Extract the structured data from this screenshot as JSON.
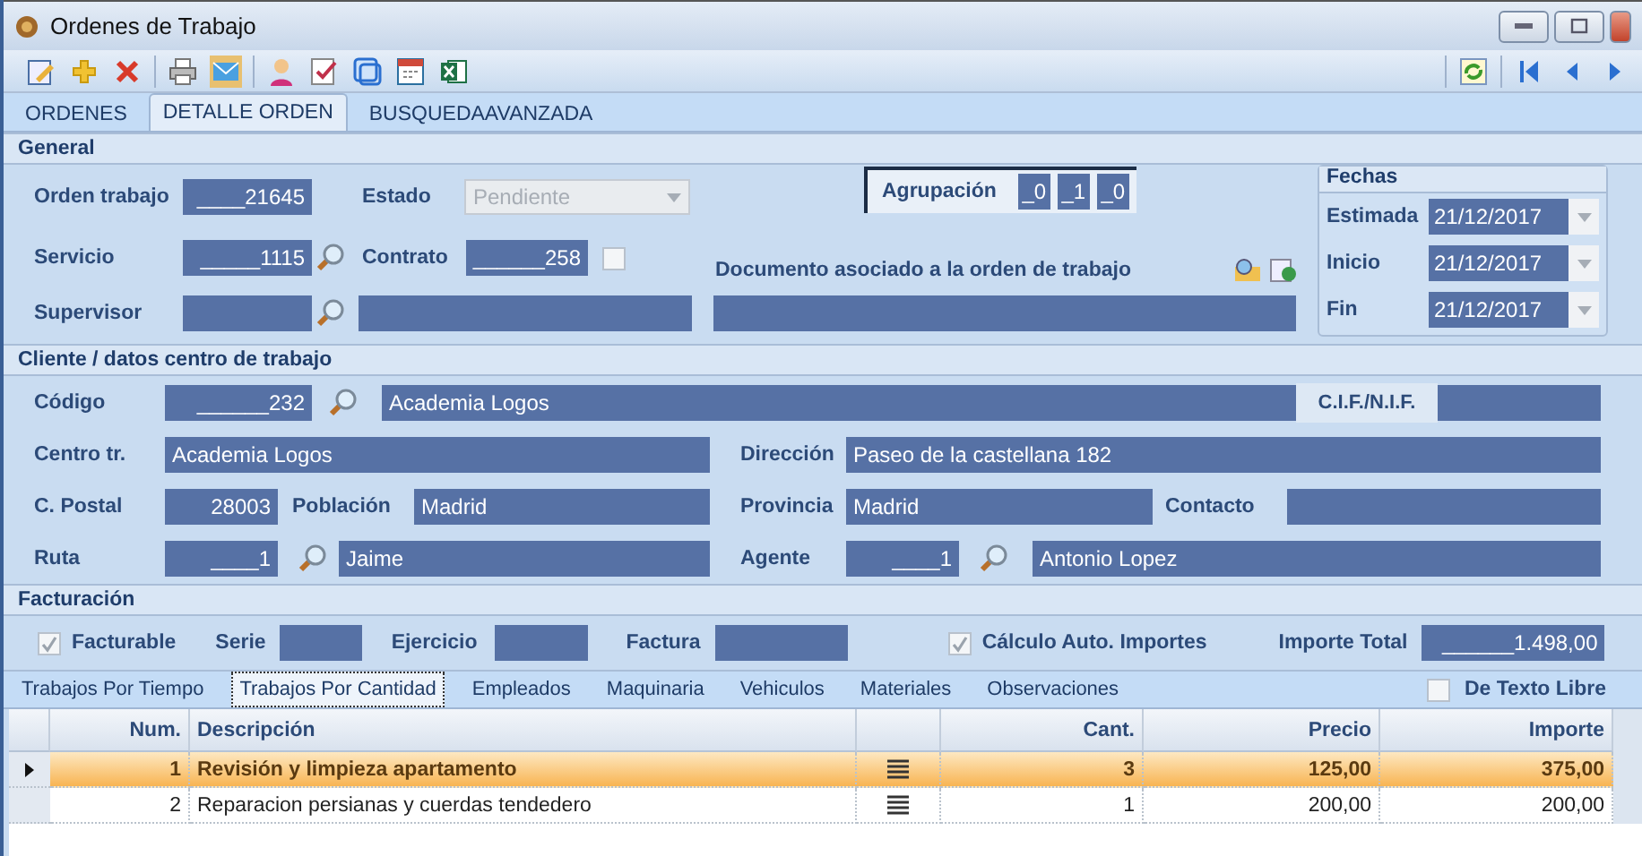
{
  "window": {
    "title": "Ordenes de Trabajo"
  },
  "tabs": [
    {
      "label": "ORDENES",
      "selected": false
    },
    {
      "label": "DETALLE ORDEN",
      "selected": true
    },
    {
      "label": "BUSQUEDAAVANZADA",
      "selected": false
    }
  ],
  "general": {
    "title": "General",
    "orden_trabajo": {
      "label": "Orden trabajo",
      "value": "____21645"
    },
    "estado": {
      "label": "Estado",
      "value": "Pendiente",
      "disabled": true
    },
    "agrupacion": {
      "label": "Agrupación",
      "values": [
        "_0",
        "_1",
        "_0"
      ]
    },
    "servicio": {
      "label": "Servicio",
      "value": "_____1115"
    },
    "contrato": {
      "label": "Contrato",
      "value": "______258",
      "checked": false
    },
    "supervisor": {
      "label": "Supervisor"
    },
    "documento": {
      "label": "Documento asociado a la orden de trabajo"
    },
    "fechas": {
      "title": "Fechas",
      "rows": [
        {
          "label": "Estimada",
          "value": "21/12/2017"
        },
        {
          "label": "Inicio",
          "value": "21/12/2017"
        },
        {
          "label": "Fin",
          "value": "21/12/2017"
        }
      ]
    }
  },
  "cliente": {
    "title": "Cliente / datos centro de trabajo",
    "codigo": {
      "label": "Código",
      "value": "______232",
      "name": "Academia Logos"
    },
    "cif": {
      "label": "C.I.F./N.I.F."
    },
    "centro": {
      "label": "Centro tr.",
      "value": "Academia Logos"
    },
    "direccion": {
      "label": "Dirección",
      "value": "Paseo de la castellana 182"
    },
    "cpostal": {
      "label": "C. Postal",
      "value": "28003"
    },
    "poblacion": {
      "label": "Población",
      "value": "Madrid"
    },
    "provincia": {
      "label": "Provincia",
      "value": "Madrid"
    },
    "contacto": {
      "label": "Contacto"
    },
    "ruta": {
      "label": "Ruta",
      "value": "____1",
      "name": "Jaime"
    },
    "agente": {
      "label": "Agente",
      "value": "____1",
      "name": "Antonio Lopez"
    }
  },
  "facturacion": {
    "title": "Facturación",
    "facturable": {
      "label": "Facturable",
      "checked": true
    },
    "serie": {
      "label": "Serie"
    },
    "ejercicio": {
      "label": "Ejercicio"
    },
    "factura": {
      "label": "Factura"
    },
    "calculo": {
      "label": "Cálculo Auto. Importes",
      "checked": true
    },
    "importe_total": {
      "label": "Importe Total",
      "value": "______1.498,00"
    }
  },
  "detail_tabs": [
    {
      "label": "Trabajos Por Tiempo",
      "selected": false
    },
    {
      "label": "Trabajos Por Cantidad",
      "selected": true
    },
    {
      "label": "Empleados",
      "selected": false
    },
    {
      "label": "Maquinaria",
      "selected": false
    },
    {
      "label": "Vehiculos",
      "selected": false
    },
    {
      "label": "Materiales",
      "selected": false
    },
    {
      "label": "Observaciones",
      "selected": false
    }
  ],
  "texto_libre": {
    "label": "De Texto Libre",
    "checked": false
  },
  "table": {
    "columns": [
      "Num.",
      "Descripción",
      "Cant.",
      "Precio",
      "Importe"
    ],
    "rows": [
      {
        "num": "1",
        "descripcion": "Revisión y limpieza apartamento",
        "cant": "3",
        "precio": "125,00",
        "importe": "375,00",
        "selected": true
      },
      {
        "num": "2",
        "descripcion": "Reparacion persianas y cuerdas tendedero",
        "cant": "1",
        "precio": "200,00",
        "importe": "200,00",
        "selected": false
      }
    ]
  }
}
